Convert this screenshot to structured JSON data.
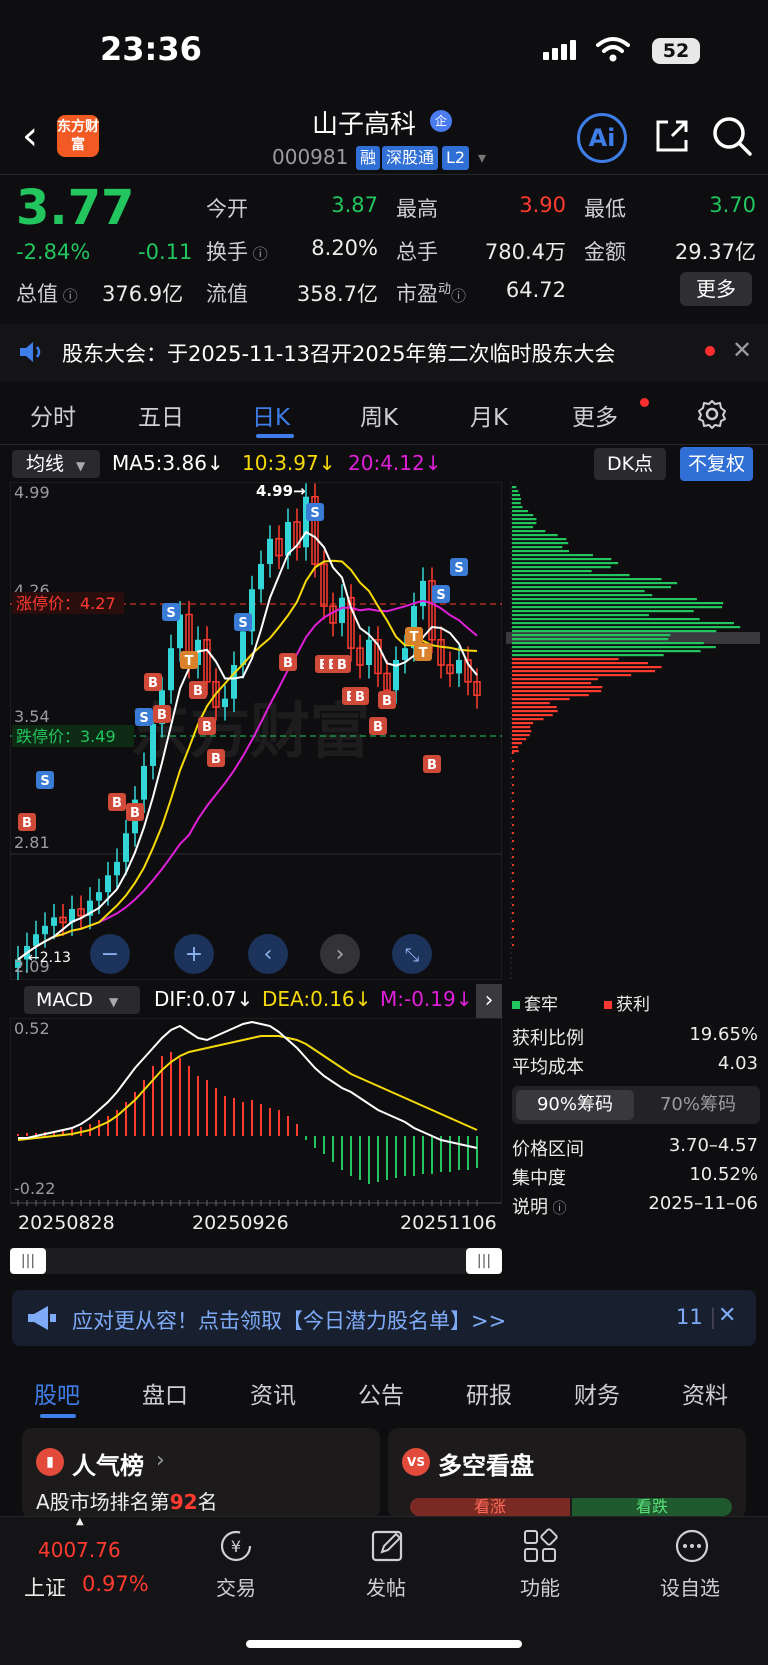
{
  "status_bar": {
    "time": "23:36",
    "battery": "52"
  },
  "header": {
    "logo_text": "东方财富",
    "stock_name": "山子高科",
    "badge": "企",
    "stock_code": "000981",
    "tags": [
      "融",
      "深股通",
      "L2"
    ],
    "ai_label": "Ai"
  },
  "quote": {
    "price": "3.77",
    "change_pct": "-2.84%",
    "change": "-0.11",
    "market_cap_label": "总值",
    "market_cap": "376.9亿",
    "fields": [
      {
        "label": "今开",
        "value": "3.87",
        "color": "#22c55e"
      },
      {
        "label": "最高",
        "value": "3.90",
        "color": "#ff3b30"
      },
      {
        "label": "最低",
        "value": "3.70",
        "color": "#22c55e"
      },
      {
        "label": "换手",
        "value": "8.20%",
        "color": "#ececec"
      },
      {
        "label": "总手",
        "value": "780.4万",
        "color": "#ececec"
      },
      {
        "label": "金额",
        "value": "29.37亿",
        "color": "#ececec"
      },
      {
        "label": "流值",
        "value": "358.7亿",
        "color": "#ececec"
      },
      {
        "label": "市盈",
        "value": "64.72",
        "color": "#ececec"
      }
    ],
    "pe_suffix": "动",
    "more_button": "更多"
  },
  "notice": {
    "text": "股东大会：于2025-11-13召开2025年第二次临时股东大会"
  },
  "period_tabs": [
    "分时",
    "五日",
    "日K",
    "周K",
    "月K",
    "更多"
  ],
  "active_period": "日K",
  "indicator_bar": {
    "ma_select": "均线",
    "ma5": "MA5:3.86↓",
    "ma10": "10:3.97↓",
    "ma20": "20:4.12↓",
    "dk_button": "DK点",
    "adjust_button": "不复权",
    "colors": {
      "ma5": "#ffffff",
      "ma10": "#f5d90a",
      "ma20": "#e020d8"
    }
  },
  "kline": {
    "y_labels": [
      "4.99",
      "4.26",
      "3.54",
      "2.81",
      "2.09"
    ],
    "limit_up_label": "涨停价：4.27",
    "limit_down_label": "跌停价：3.49",
    "high_marker": "4.99→",
    "low_marker": "←2.13",
    "signals_s": "S",
    "signals_b": "B",
    "signals_t": "T"
  },
  "macd": {
    "select": "MACD",
    "dif": "DIF:0.07↓",
    "dea": "DEA:0.16↓",
    "m": "M:-0.19↓",
    "y_top": "0.52",
    "y_bottom": "-0.22",
    "dates": [
      "20250828",
      "20250926",
      "20251106"
    ]
  },
  "chips": {
    "legend_locked": "套牢",
    "legend_profit": "获利",
    "rows": [
      {
        "label": "获利比例",
        "value": "19.65%"
      },
      {
        "label": "平均成本",
        "value": "4.03"
      }
    ],
    "toggle": [
      "90%筹码",
      "70%筹码"
    ],
    "rows2": [
      {
        "label": "价格区间",
        "value": "3.70–4.57"
      },
      {
        "label": "集中度",
        "value": "10.52%"
      },
      {
        "label": "说明",
        "value": "2025–11–06"
      }
    ]
  },
  "promo": {
    "text": "应对更从容！点击领取【今日潜力股名单】>>",
    "count": "11"
  },
  "bottom_tabs": [
    "股吧",
    "盘口",
    "资讯",
    "公告",
    "研报",
    "财务",
    "资料"
  ],
  "cards": {
    "popular_title": "人气榜",
    "popular_rank_prefix": "A股市场排名第",
    "popular_rank": "92",
    "popular_rank_suffix": "名",
    "vs_title": "多空看盘",
    "vs_up": "看涨",
    "vs_down": "看跌"
  },
  "nav": {
    "index_value": "4007.76",
    "index_name": "上证",
    "index_pct": "0.97%",
    "items": [
      "交易",
      "发帖",
      "功能",
      "设自选"
    ]
  }
}
